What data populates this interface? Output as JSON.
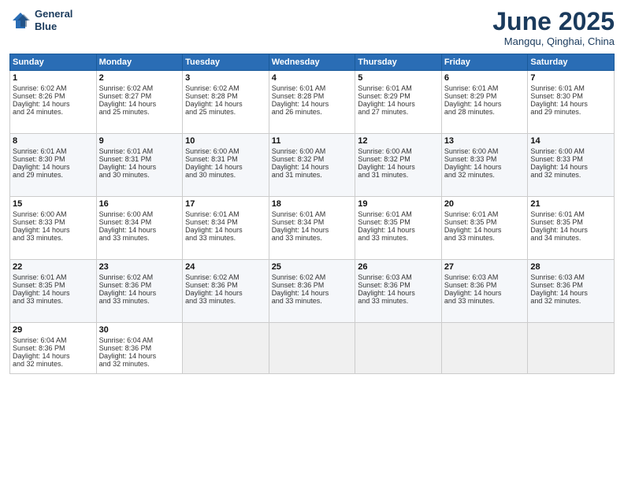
{
  "header": {
    "logo_line1": "General",
    "logo_line2": "Blue",
    "month": "June 2025",
    "location": "Mangqu, Qinghai, China"
  },
  "weekdays": [
    "Sunday",
    "Monday",
    "Tuesday",
    "Wednesday",
    "Thursday",
    "Friday",
    "Saturday"
  ],
  "weeks": [
    [
      {
        "day": "1",
        "text": "Sunrise: 6:02 AM\nSunset: 8:26 PM\nDaylight: 14 hours\nand 24 minutes."
      },
      {
        "day": "2",
        "text": "Sunrise: 6:02 AM\nSunset: 8:27 PM\nDaylight: 14 hours\nand 25 minutes."
      },
      {
        "day": "3",
        "text": "Sunrise: 6:02 AM\nSunset: 8:28 PM\nDaylight: 14 hours\nand 25 minutes."
      },
      {
        "day": "4",
        "text": "Sunrise: 6:01 AM\nSunset: 8:28 PM\nDaylight: 14 hours\nand 26 minutes."
      },
      {
        "day": "5",
        "text": "Sunrise: 6:01 AM\nSunset: 8:29 PM\nDaylight: 14 hours\nand 27 minutes."
      },
      {
        "day": "6",
        "text": "Sunrise: 6:01 AM\nSunset: 8:29 PM\nDaylight: 14 hours\nand 28 minutes."
      },
      {
        "day": "7",
        "text": "Sunrise: 6:01 AM\nSunset: 8:30 PM\nDaylight: 14 hours\nand 29 minutes."
      }
    ],
    [
      {
        "day": "8",
        "text": "Sunrise: 6:01 AM\nSunset: 8:30 PM\nDaylight: 14 hours\nand 29 minutes."
      },
      {
        "day": "9",
        "text": "Sunrise: 6:01 AM\nSunset: 8:31 PM\nDaylight: 14 hours\nand 30 minutes."
      },
      {
        "day": "10",
        "text": "Sunrise: 6:00 AM\nSunset: 8:31 PM\nDaylight: 14 hours\nand 30 minutes."
      },
      {
        "day": "11",
        "text": "Sunrise: 6:00 AM\nSunset: 8:32 PM\nDaylight: 14 hours\nand 31 minutes."
      },
      {
        "day": "12",
        "text": "Sunrise: 6:00 AM\nSunset: 8:32 PM\nDaylight: 14 hours\nand 31 minutes."
      },
      {
        "day": "13",
        "text": "Sunrise: 6:00 AM\nSunset: 8:33 PM\nDaylight: 14 hours\nand 32 minutes."
      },
      {
        "day": "14",
        "text": "Sunrise: 6:00 AM\nSunset: 8:33 PM\nDaylight: 14 hours\nand 32 minutes."
      }
    ],
    [
      {
        "day": "15",
        "text": "Sunrise: 6:00 AM\nSunset: 8:33 PM\nDaylight: 14 hours\nand 33 minutes."
      },
      {
        "day": "16",
        "text": "Sunrise: 6:00 AM\nSunset: 8:34 PM\nDaylight: 14 hours\nand 33 minutes."
      },
      {
        "day": "17",
        "text": "Sunrise: 6:01 AM\nSunset: 8:34 PM\nDaylight: 14 hours\nand 33 minutes."
      },
      {
        "day": "18",
        "text": "Sunrise: 6:01 AM\nSunset: 8:34 PM\nDaylight: 14 hours\nand 33 minutes."
      },
      {
        "day": "19",
        "text": "Sunrise: 6:01 AM\nSunset: 8:35 PM\nDaylight: 14 hours\nand 33 minutes."
      },
      {
        "day": "20",
        "text": "Sunrise: 6:01 AM\nSunset: 8:35 PM\nDaylight: 14 hours\nand 33 minutes."
      },
      {
        "day": "21",
        "text": "Sunrise: 6:01 AM\nSunset: 8:35 PM\nDaylight: 14 hours\nand 34 minutes."
      }
    ],
    [
      {
        "day": "22",
        "text": "Sunrise: 6:01 AM\nSunset: 8:35 PM\nDaylight: 14 hours\nand 33 minutes."
      },
      {
        "day": "23",
        "text": "Sunrise: 6:02 AM\nSunset: 8:36 PM\nDaylight: 14 hours\nand 33 minutes."
      },
      {
        "day": "24",
        "text": "Sunrise: 6:02 AM\nSunset: 8:36 PM\nDaylight: 14 hours\nand 33 minutes."
      },
      {
        "day": "25",
        "text": "Sunrise: 6:02 AM\nSunset: 8:36 PM\nDaylight: 14 hours\nand 33 minutes."
      },
      {
        "day": "26",
        "text": "Sunrise: 6:03 AM\nSunset: 8:36 PM\nDaylight: 14 hours\nand 33 minutes."
      },
      {
        "day": "27",
        "text": "Sunrise: 6:03 AM\nSunset: 8:36 PM\nDaylight: 14 hours\nand 33 minutes."
      },
      {
        "day": "28",
        "text": "Sunrise: 6:03 AM\nSunset: 8:36 PM\nDaylight: 14 hours\nand 32 minutes."
      }
    ],
    [
      {
        "day": "29",
        "text": "Sunrise: 6:04 AM\nSunset: 8:36 PM\nDaylight: 14 hours\nand 32 minutes."
      },
      {
        "day": "30",
        "text": "Sunrise: 6:04 AM\nSunset: 8:36 PM\nDaylight: 14 hours\nand 32 minutes."
      },
      {
        "day": "",
        "text": ""
      },
      {
        "day": "",
        "text": ""
      },
      {
        "day": "",
        "text": ""
      },
      {
        "day": "",
        "text": ""
      },
      {
        "day": "",
        "text": ""
      }
    ]
  ]
}
